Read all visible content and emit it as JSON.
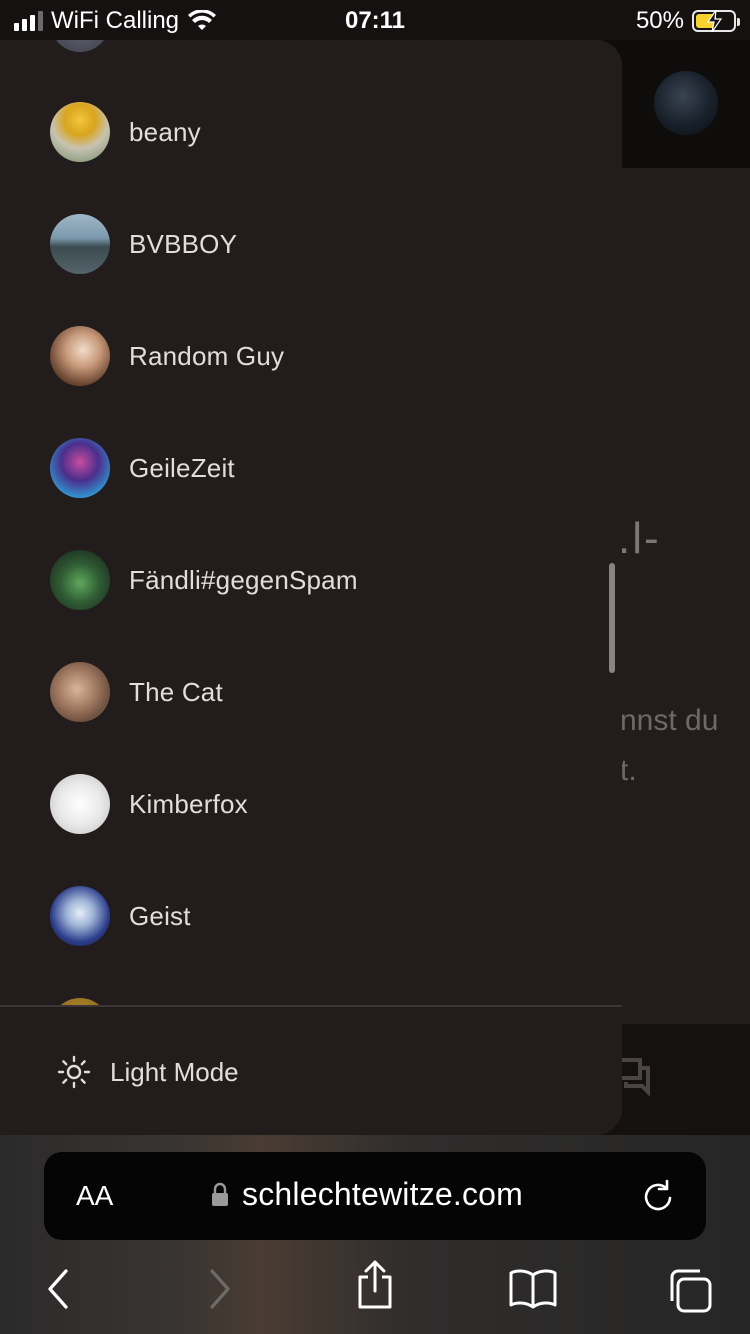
{
  "status_bar": {
    "carrier": "WiFi Calling",
    "time": "07:11",
    "battery_percent": "50%",
    "battery_level": 0.5,
    "battery_color": "#f5d22e"
  },
  "drawer": {
    "users": [
      {
        "name": "beany",
        "avatar": "beany-avatar"
      },
      {
        "name": "BVBBOY",
        "avatar": "bvbboy-avatar"
      },
      {
        "name": "Random Guy",
        "avatar": "random-guy-avatar"
      },
      {
        "name": "GeileZeit",
        "avatar": "geilezeit-avatar"
      },
      {
        "name": "Fändli#gegenSpam",
        "avatar": "faendli-avatar"
      },
      {
        "name": "The Cat",
        "avatar": "the-cat-avatar"
      },
      {
        "name": "Kimberfox",
        "avatar": "kimberfox-avatar"
      },
      {
        "name": "Geist",
        "avatar": "geist-avatar"
      }
    ],
    "mode_toggle": {
      "label": "Light Mode",
      "icon": "sun-icon"
    }
  },
  "background_page": {
    "title_fragment": ".l-",
    "text_line_1": "nnst du",
    "text_line_2": "t."
  },
  "browser": {
    "text_size_label": "AA",
    "url": "schlechtewitze.com",
    "toolbar": [
      "back-icon",
      "forward-icon",
      "share-icon",
      "bookmarks-icon",
      "tabs-icon"
    ]
  }
}
